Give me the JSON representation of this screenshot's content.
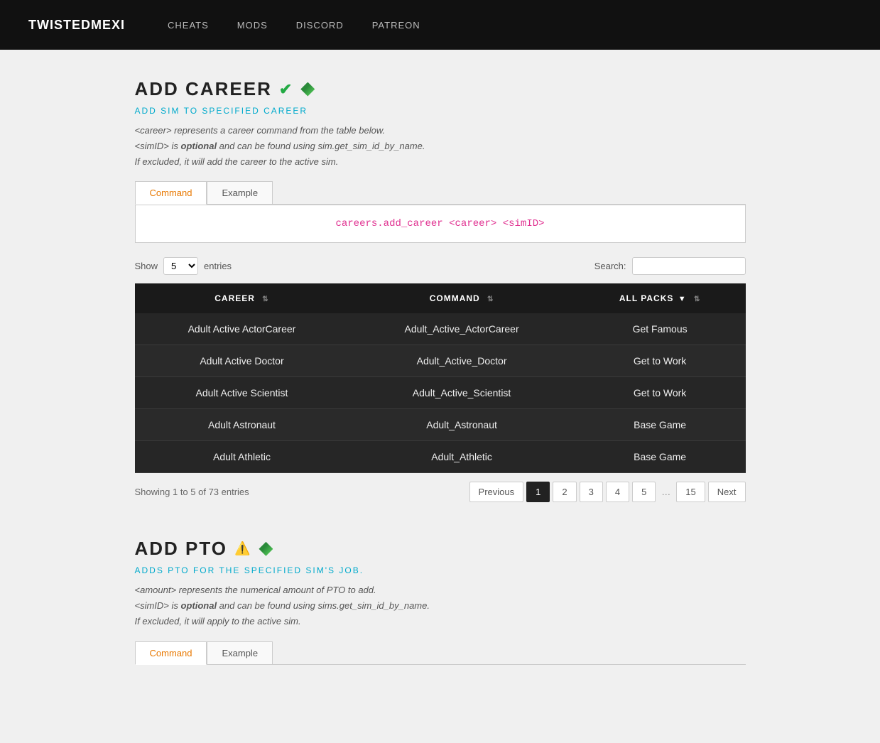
{
  "navbar": {
    "brand": "TWISTEDMEXI",
    "links": [
      {
        "label": "CHEATS",
        "href": "#"
      },
      {
        "label": "MODS",
        "href": "#"
      },
      {
        "label": "DISCORD",
        "href": "#"
      },
      {
        "label": "PATREON",
        "href": "#"
      }
    ]
  },
  "addCareer": {
    "title": "ADD CAREER",
    "subtitle": "ADD SIM TO SPECIFIED CAREER",
    "description_lines": [
      "<career> represents a career command from the table below.",
      "<simID> is optional and can be found using sim.get_sim_id_by_name.",
      "If excluded, it will add the career to the active sim."
    ],
    "tabs": [
      {
        "label": "Command",
        "active": true
      },
      {
        "label": "Example",
        "active": false
      }
    ],
    "command": "careers.add_career <career> <simID>",
    "show_label": "Show",
    "show_value": "5",
    "entries_label": "entries",
    "search_label": "Search:",
    "search_placeholder": "",
    "table": {
      "columns": [
        {
          "label": "CAREER",
          "sortable": true
        },
        {
          "label": "COMMAND",
          "sortable": true
        },
        {
          "label": "ALL PACKS",
          "sortable": true,
          "dropdown": true
        }
      ],
      "rows": [
        {
          "career": "Adult Active ActorCareer",
          "command": "Adult_Active_ActorCareer",
          "pack": "Get Famous"
        },
        {
          "career": "Adult Active Doctor",
          "command": "Adult_Active_Doctor",
          "pack": "Get to Work"
        },
        {
          "career": "Adult Active Scientist",
          "command": "Adult_Active_Scientist",
          "pack": "Get to Work"
        },
        {
          "career": "Adult Astronaut",
          "command": "Adult_Astronaut",
          "pack": "Base Game"
        },
        {
          "career": "Adult Athletic",
          "command": "Adult_Athletic",
          "pack": "Base Game"
        }
      ]
    },
    "pagination": {
      "showing_text": "Showing 1 to 5 of 73 entries",
      "previous_label": "Previous",
      "next_label": "Next",
      "pages": [
        "1",
        "2",
        "3",
        "4",
        "5",
        "...",
        "15"
      ],
      "active_page": "1"
    }
  },
  "addPto": {
    "title": "ADD PTO",
    "subtitle": "ADDS PTO FOR THE SPECIFIED SIM'S JOB.",
    "description_lines": [
      "<amount> represents the numerical amount of PTO to add.",
      "<simID> is optional and can be found using sims.get_sim_id_by_name.",
      "If excluded, it will apply to the active sim."
    ],
    "tabs": [
      {
        "label": "Command",
        "active": true
      },
      {
        "label": "Example",
        "active": false
      }
    ]
  }
}
